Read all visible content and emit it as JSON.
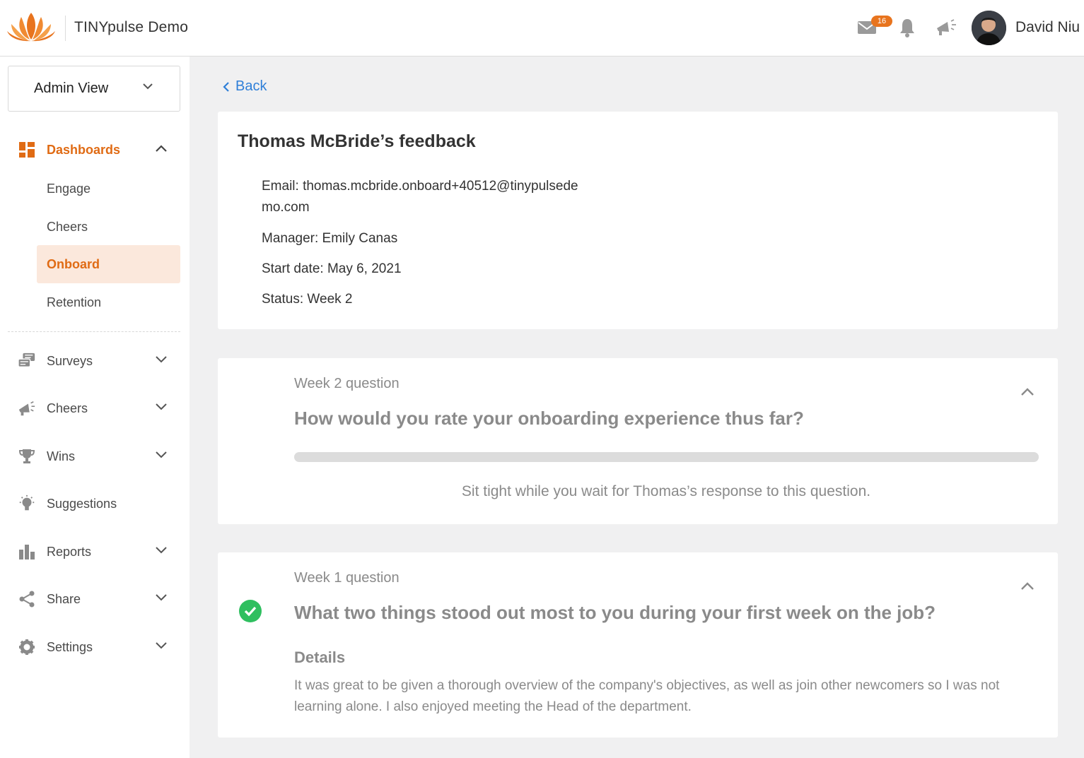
{
  "header": {
    "brand": "TINYpulse Demo",
    "mail_badge": "16",
    "user_name": "David Niu"
  },
  "sidebar": {
    "view_select": "Admin View",
    "dashboards": {
      "label": "Dashboards",
      "items": [
        "Engage",
        "Cheers",
        "Onboard",
        "Retention"
      ]
    },
    "nav": [
      {
        "label": "Surveys"
      },
      {
        "label": "Cheers"
      },
      {
        "label": "Wins"
      },
      {
        "label": "Suggestions"
      },
      {
        "label": "Reports"
      },
      {
        "label": "Share"
      },
      {
        "label": "Settings"
      }
    ]
  },
  "main": {
    "back_label": "Back",
    "feedback": {
      "title": "Thomas McBride’s feedback",
      "email": "Email: thomas.mcbride.onboard+40512@tinypulsedemo.com",
      "manager": "Manager: Emily Canas",
      "start_date": "Start date: May 6, 2021",
      "status": "Status: Week 2"
    },
    "questions": [
      {
        "week": "Week 2 question",
        "text": "How would you rate your onboarding experience thus far?",
        "wait": "Sit tight while you wait for Thomas’s response to this question.",
        "progress": 0
      },
      {
        "week": "Week 1 question",
        "text": "What two things stood out most to you during your first week on the job?",
        "details_label": "Details",
        "details": "It was great to be given a thorough overview of the company's objectives, as well as join other newcomers so I was not learning alone.  I also enjoyed meeting the Head of the department."
      }
    ]
  },
  "colors": {
    "accent": "#e06b14",
    "link": "#2f7fd8",
    "success": "#2fbf5f"
  }
}
